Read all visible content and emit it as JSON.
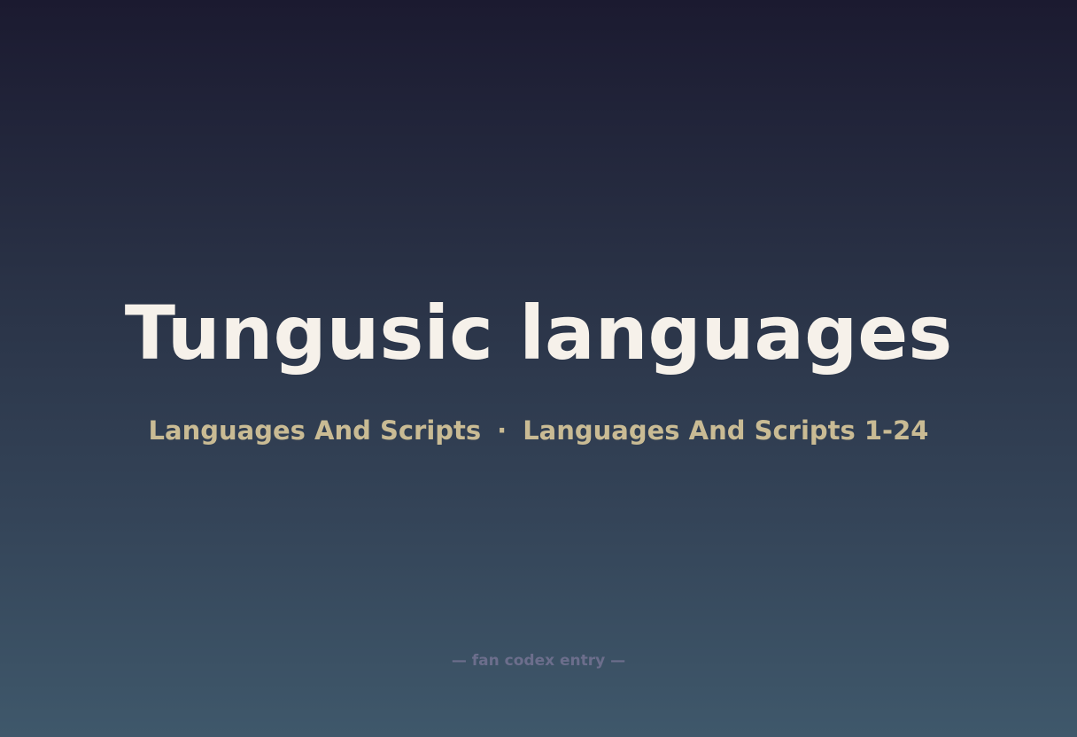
{
  "title": "Tungusic languages",
  "subtitle": {
    "category": "Languages And Scripts",
    "separator": "·",
    "series": "Languages And Scripts 1-24"
  },
  "footer": "— fan codex entry —",
  "colors": {
    "title": "#f6f1ea",
    "subtitle": "#c9bb94",
    "footer": "#6c6e8c",
    "background_top": "#1b1a30",
    "background_bottom": "#3f586b"
  }
}
